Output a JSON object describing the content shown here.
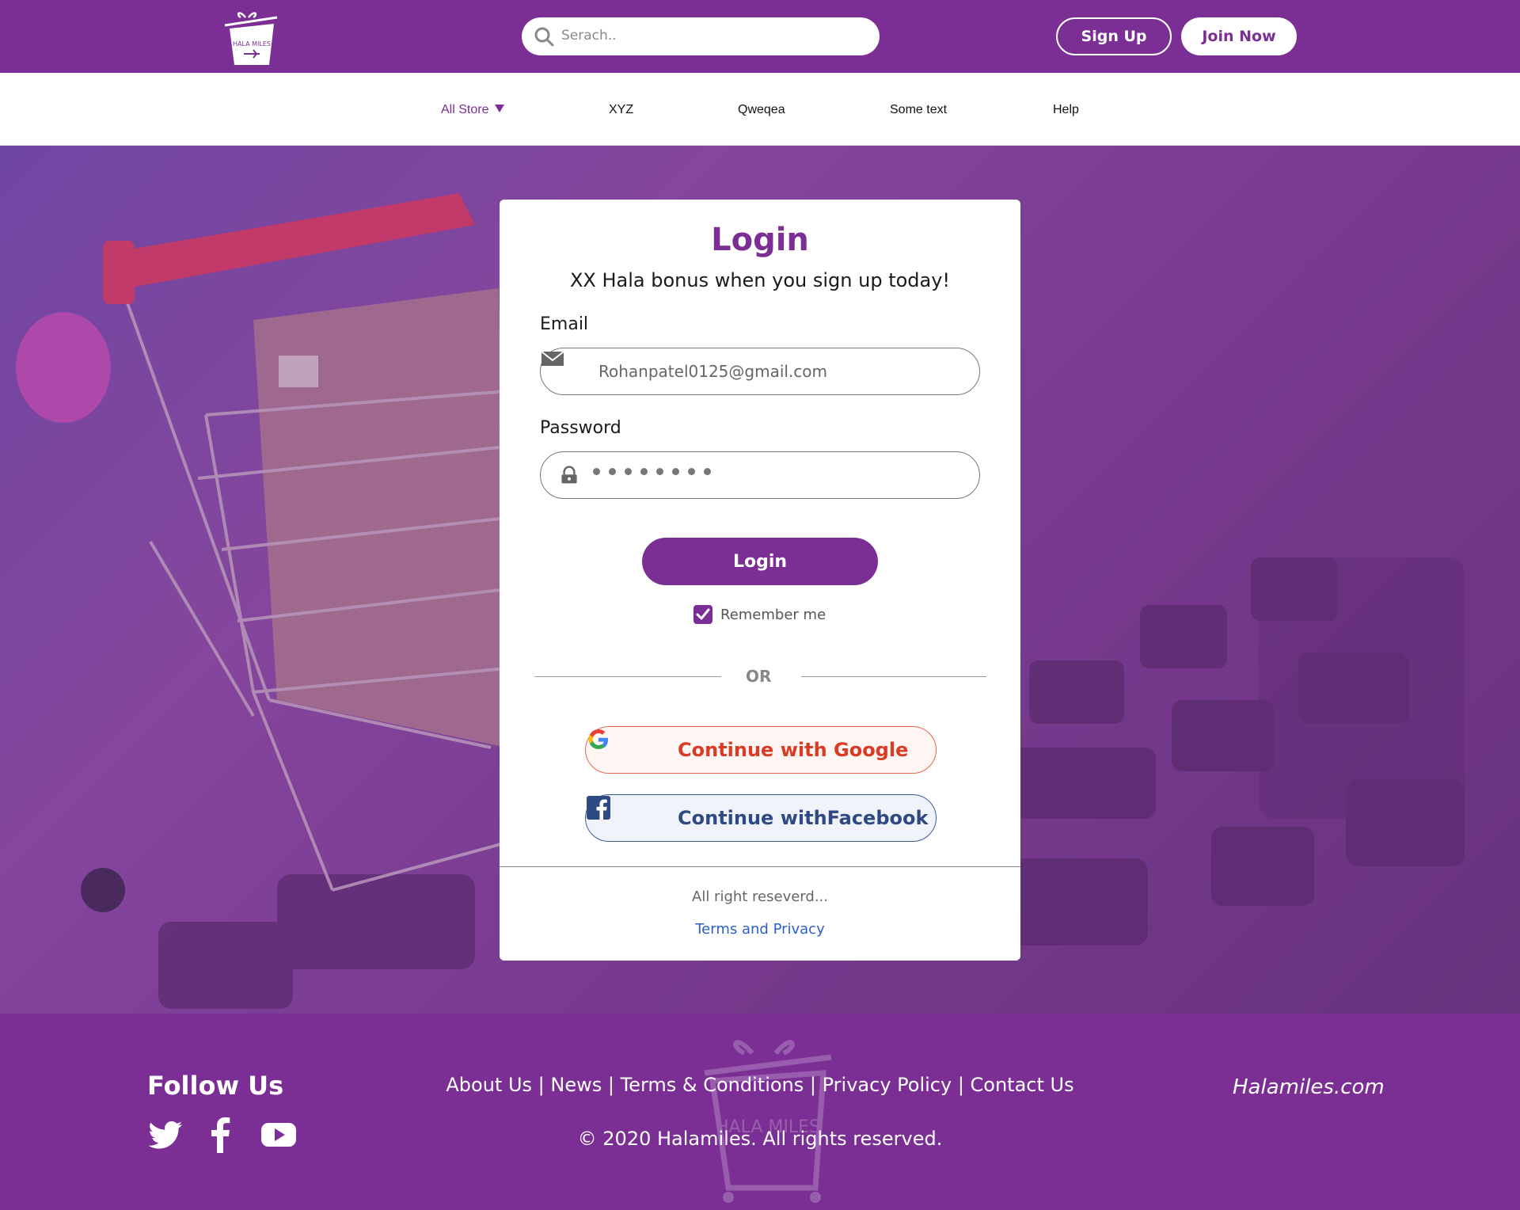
{
  "header": {
    "logo_text": "HALA MILES",
    "search_placeholder": "Serach..",
    "signup_label": "Sign Up",
    "join_label": "Join Now"
  },
  "nav": {
    "items": [
      {
        "label": "All Store",
        "active": true
      },
      {
        "label": "XYZ"
      },
      {
        "label": "Qweqea"
      },
      {
        "label": "Some text"
      },
      {
        "label": "Help"
      }
    ]
  },
  "login": {
    "title": "Login",
    "subtitle": "XX Hala bonus when you sign up today!",
    "email_label": "Email",
    "email_value": "Rohanpatel0125@gmail.com",
    "password_label": "Password",
    "password_mask_count": 8,
    "login_button": "Login",
    "remember_label": "Remember me",
    "remember_checked": true,
    "or_text": "OR",
    "google_label": "Continue with Google",
    "facebook_label": "Continue withFacebook",
    "rights_text": "All right reseverd...",
    "terms_link": "Terms and Privacy"
  },
  "footer": {
    "follow_title": "Follow Us",
    "social_icons": [
      "twitter-icon",
      "facebook-icon",
      "youtube-icon"
    ],
    "links": [
      "About Us",
      "News",
      "Terms & Conditions",
      "Privacy Policy",
      "Contact Us"
    ],
    "separator": " | ",
    "copyright": "© 2020 Halamiles. All rights reserved.",
    "site": "Halamiles.com",
    "watermark_text": "HALA MILES"
  },
  "colors": {
    "brand": "#7b2f95",
    "google_text": "#d93b25",
    "facebook_text": "#2f4a82",
    "link": "#2a5ec9"
  }
}
